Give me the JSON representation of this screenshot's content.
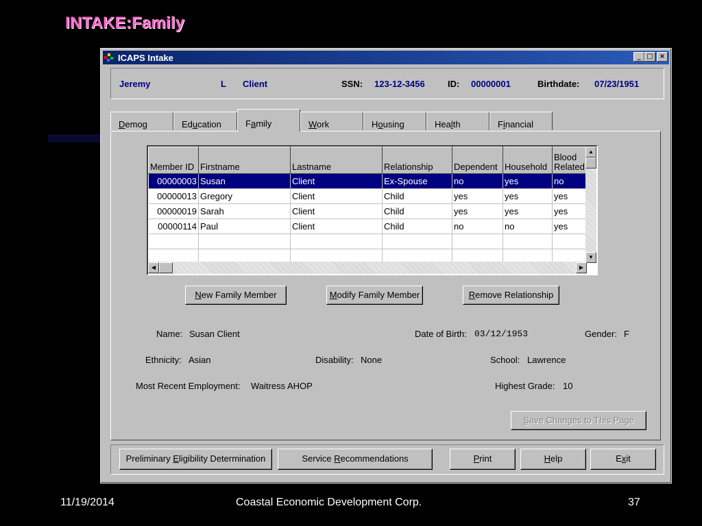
{
  "slide": {
    "title": "INTAKE:Family",
    "footer_date": "11/19/2014",
    "footer_org": "Coastal Economic Development Corp.",
    "footer_page": "37"
  },
  "window": {
    "title": "ICAPS Intake",
    "controls": [
      "_",
      "□",
      "×"
    ]
  },
  "client": {
    "first": "Jeremy",
    "middle": "L",
    "last": "Client",
    "ssn_label": "SSN:",
    "ssn": "123-12-3456",
    "id_label": "ID:",
    "id": "00000001",
    "birth_label": "Birthdate:",
    "birthdate": "07/23/1951"
  },
  "tabs": [
    {
      "pre": "",
      "key": "D",
      "post": "emog"
    },
    {
      "pre": "Ed",
      "key": "u",
      "post": "cation"
    },
    {
      "pre": "F",
      "key": "a",
      "post": "mily"
    },
    {
      "pre": "",
      "key": "W",
      "post": "ork"
    },
    {
      "pre": "H",
      "key": "o",
      "post": "using"
    },
    {
      "pre": "Hea",
      "key": "l",
      "post": "th"
    },
    {
      "pre": "F",
      "key": "i",
      "post": "nancial"
    }
  ],
  "active_tab": 2,
  "grid": {
    "columns": [
      "Member ID",
      "Firstname",
      "Lastname",
      "Relationship",
      "Dependent",
      "Household",
      "Blood\nRelated"
    ],
    "rows": [
      [
        "00000003",
        "Susan",
        "Client",
        "Ex-Spouse",
        "no",
        "yes",
        "no"
      ],
      [
        "00000013",
        "Gregory",
        "Client",
        "Child",
        "yes",
        "yes",
        "yes"
      ],
      [
        "00000019",
        "Sarah",
        "Client",
        "Child",
        "yes",
        "yes",
        "yes"
      ],
      [
        "00000114",
        "Paul",
        "Client",
        "Child",
        "no",
        "no",
        "yes"
      ],
      [
        "",
        "",
        "",
        "",
        "",
        "",
        ""
      ],
      [
        "",
        "",
        "",
        "",
        "",
        "",
        ""
      ]
    ],
    "selected_row": 0
  },
  "buttons": {
    "new_member": {
      "pre": "",
      "key": "N",
      "post": "ew Family Member"
    },
    "modify_member": {
      "pre": "",
      "key": "M",
      "post": "odify Family Member"
    },
    "remove_rel": {
      "pre": "",
      "key": "R",
      "post": "emove Relationship"
    },
    "save": {
      "pre": "",
      "key": "S",
      "post": "ave Changes to This Page"
    },
    "prelim": {
      "pre": "Preliminary ",
      "key": "E",
      "post": "ligibility Determination"
    },
    "service": {
      "pre": "Service ",
      "key": "R",
      "post": "ecommendations"
    },
    "print": {
      "pre": "",
      "key": "P",
      "post": "rint"
    },
    "help": {
      "pre": "",
      "key": "H",
      "post": "elp"
    },
    "exit": {
      "pre": "E",
      "key": "x",
      "post": "it"
    }
  },
  "details": {
    "name_label": "Name:",
    "name": "Susan Client",
    "dob_label": "Date of Birth:",
    "dob": "03/12/1953",
    "gender_label": "Gender:",
    "gender": "F",
    "ethnicity_label": "Ethnicity:",
    "ethnicity": "Asian",
    "disability_label": "Disability:",
    "disability": "None",
    "school_label": "School:",
    "school": "Lawrence",
    "employment_label": "Most Recent Employment:",
    "employment": "Waitress AHOP",
    "grade_label": "Highest Grade:",
    "grade": "10"
  }
}
